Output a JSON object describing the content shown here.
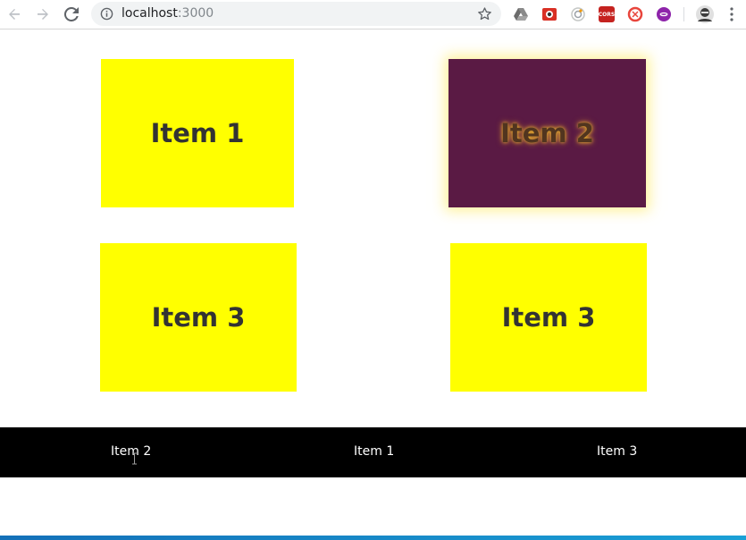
{
  "browser": {
    "url_host": "localhost",
    "url_port": ":3000",
    "icons": {
      "back": "arrow-left-icon",
      "forward": "arrow-right-icon",
      "reload": "reload-icon",
      "site_info": "info-icon",
      "bookmark": "star-icon",
      "menu": "kebab-menu-icon"
    },
    "extensions": [
      {
        "name": "google-drive-icon",
        "color": "#7c7c7c"
      },
      {
        "name": "red-camera-icon",
        "color": "#d93025"
      },
      {
        "name": "circle-spinner-icon",
        "color": "#9aa0a6"
      },
      {
        "name": "cors-icon",
        "color": "#c5221f",
        "text": "CORS"
      },
      {
        "name": "red-ring-icon",
        "color": "#e8453c"
      },
      {
        "name": "purple-badge-icon",
        "color": "#8e24aa"
      }
    ]
  },
  "cards": [
    {
      "label": "Item 1",
      "color": "#ffff00",
      "active": false
    },
    {
      "label": "Item 2",
      "color": "#5a1a44",
      "active": true
    },
    {
      "label": "Item 3",
      "color": "#ffff00",
      "active": false
    },
    {
      "label": "Item 3",
      "color": "#ffff00",
      "active": false
    }
  ],
  "footer_nav": {
    "background": "#000000",
    "items": [
      "Item 2",
      "Item 1",
      "Item 3"
    ]
  },
  "colors": {
    "card_yellow": "#ffff00",
    "card_active": "#5a1a44",
    "text_dark": "#333333"
  }
}
